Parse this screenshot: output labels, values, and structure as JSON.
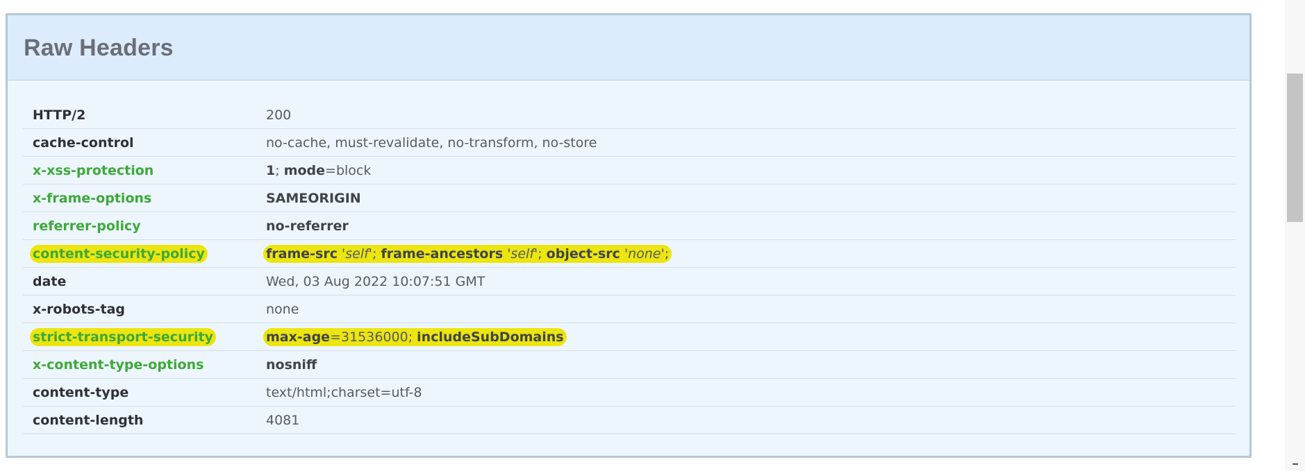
{
  "panel": {
    "title": "Raw Headers"
  },
  "headers": [
    {
      "name": "HTTP/2",
      "secure": false,
      "value_parts": [
        {
          "t": "200",
          "s": "plain"
        }
      ]
    },
    {
      "name": "cache-control",
      "secure": false,
      "value_parts": [
        {
          "t": "no-cache, must-revalidate, no-transform, no-store",
          "s": "plain"
        }
      ]
    },
    {
      "name": "x-xss-protection",
      "secure": true,
      "value_parts": [
        {
          "t": "1",
          "s": "bold"
        },
        {
          "t": "; ",
          "s": "plain"
        },
        {
          "t": "mode",
          "s": "bold"
        },
        {
          "t": "=block",
          "s": "plain"
        }
      ]
    },
    {
      "name": "x-frame-options",
      "secure": true,
      "value_parts": [
        {
          "t": "SAMEORIGIN",
          "s": "bold"
        }
      ]
    },
    {
      "name": "referrer-policy",
      "secure": true,
      "value_parts": [
        {
          "t": "no-referrer",
          "s": "bold"
        }
      ]
    },
    {
      "name": "content-security-policy",
      "secure": true,
      "highlighted": true,
      "value_parts": [
        {
          "t": "frame-src",
          "s": "bold"
        },
        {
          "t": " ",
          "s": "plain"
        },
        {
          "t": "'self'",
          "s": "italic"
        },
        {
          "t": "; ",
          "s": "plain"
        },
        {
          "t": "frame-ancestors",
          "s": "bold"
        },
        {
          "t": " ",
          "s": "plain"
        },
        {
          "t": "'self'",
          "s": "italic"
        },
        {
          "t": "; ",
          "s": "plain"
        },
        {
          "t": "object-src",
          "s": "bold"
        },
        {
          "t": " ",
          "s": "plain"
        },
        {
          "t": "'none'",
          "s": "italic"
        },
        {
          "t": ";",
          "s": "plain"
        }
      ]
    },
    {
      "name": "date",
      "secure": false,
      "value_parts": [
        {
          "t": "Wed, 03 Aug 2022 10:07:51 GMT",
          "s": "plain"
        }
      ]
    },
    {
      "name": "x-robots-tag",
      "secure": false,
      "value_parts": [
        {
          "t": "none",
          "s": "plain"
        }
      ]
    },
    {
      "name": "strict-transport-security",
      "secure": true,
      "highlighted": true,
      "value_parts": [
        {
          "t": "max-age",
          "s": "bold"
        },
        {
          "t": "=31536000; ",
          "s": "plain"
        },
        {
          "t": "includeSubDomains",
          "s": "bold"
        }
      ]
    },
    {
      "name": "x-content-type-options",
      "secure": true,
      "value_parts": [
        {
          "t": "nosniff",
          "s": "bold"
        }
      ]
    },
    {
      "name": "content-type",
      "secure": false,
      "value_parts": [
        {
          "t": "text/html;charset=utf-8",
          "s": "plain"
        }
      ]
    },
    {
      "name": "content-length",
      "secure": false,
      "value_parts": [
        {
          "t": "4081",
          "s": "plain"
        }
      ]
    }
  ],
  "colors": {
    "secure_header": "#3da93a",
    "highlight": "#ece50f",
    "panel_heading_bg": "#dcecfc"
  }
}
